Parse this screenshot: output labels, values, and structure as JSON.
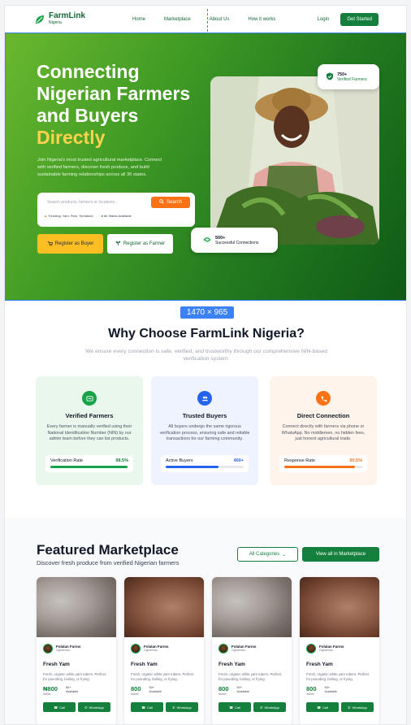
{
  "nav": {
    "logo_name": "FarmLink",
    "logo_sub": "Nigeria",
    "links": [
      "Home",
      "Marketplace",
      "About Us",
      "How it works"
    ],
    "login": "Login",
    "cta": "Get Started"
  },
  "hero": {
    "title_line1": "Connecting",
    "title_line2": "Nigerian Farmers",
    "title_line3": "and Buyers",
    "title_highlight": "Directly",
    "description": "Join Nigeria's most trusted agricultural marketplace. Connect with verified farmers, discover fresh produce, and build sustainable farming relationships across all 36 states.",
    "search_placeholder": "Search products, farmers or locations...",
    "search_button": "Search",
    "trending": "Trending: Yam, Rice, Tomatoes",
    "all_states": "All States Available",
    "btn_buyer": "Register as Buyer",
    "btn_farmer": "Register as Farmer",
    "badge_top_number": "750+",
    "badge_top_label": "Verified Farmers",
    "badge_bottom_number": "500+",
    "badge_bottom_label": "Successful Connections"
  },
  "size_tag": "1470 × 965",
  "why": {
    "title": "Why Choose FarmLink Nigeria?",
    "subtitle": "We ensure every connection is safe, verified, and trustworthy through our comprehensive NIN-based verification system.",
    "cards": [
      {
        "title": "Verified Farmers",
        "text": "Every farmer is manually verified using their National Identification Number (NIN) by our admin team before they can list products.",
        "stat_label": "Verification Rate",
        "stat_value": "98.5%",
        "fill": 0.985
      },
      {
        "title": "Trusted Buyers",
        "text": "All buyers undergo the same rigorous verification process, ensuring safe and reliable transactions for our farming community.",
        "stat_label": "Active Buyers",
        "stat_value": "400+",
        "fill": 0.68
      },
      {
        "title": "Direct Connection",
        "text": "Connect directly with farmers via phone or WhatsApp. No middlemen, no hidden fees, just honest agricultural trade.",
        "stat_label": "Response Rate",
        "stat_value": "90.5%",
        "fill": 0.905
      }
    ]
  },
  "market": {
    "title": "Featured Marketplace",
    "subtitle": "Discover fresh produce from verified Nigerian farmers",
    "categories": "All Categories",
    "view_all": "View all in Marketplace",
    "products": [
      {
        "seller": "Folalan Farms",
        "location": "Ogbomoso",
        "name": "Fresh Yam",
        "desc": "Fresh, organic white yam tubers. Perfect for pounding, boiling, or frying.",
        "price": "₦800",
        "unit": "/tuber",
        "available": "50+",
        "available_label": "Available",
        "call": "Call",
        "whatsapp": "WhatsApp"
      },
      {
        "seller": "Folalan Farms",
        "location": "Ogbomoso",
        "name": "Fresh Yam",
        "desc": "Fresh, organic white yam tubers. Perfect for pounding, boiling, or frying.",
        "price": "800",
        "unit": "/tuber",
        "available": "50+",
        "available_label": "Available",
        "call": "Call",
        "whatsapp": "WhatsApp"
      },
      {
        "seller": "Folalan Farms",
        "location": "Ogbomoso",
        "name": "Fresh Yam",
        "desc": "Fresh, organic white yam tubers. Perfect for pounding, boiling, or frying.",
        "price": "800",
        "unit": "/tuber",
        "available": "50+",
        "available_label": "Available",
        "call": "Call",
        "whatsapp": "WhatsApp"
      },
      {
        "seller": "Folalan Farms",
        "location": "Ogbomoso",
        "name": "Fresh Yam",
        "desc": "Fresh, organic white yam tubers. Perfect for pounding, boiling, or frying.",
        "price": "800",
        "unit": "/tuber",
        "available": "50+",
        "available_label": "Available",
        "call": "Call",
        "whatsapp": "WhatsApp"
      }
    ]
  },
  "colors": {
    "brand_green": "#15803d",
    "accent_orange": "#f97316",
    "accent_yellow": "#fbbf24"
  }
}
